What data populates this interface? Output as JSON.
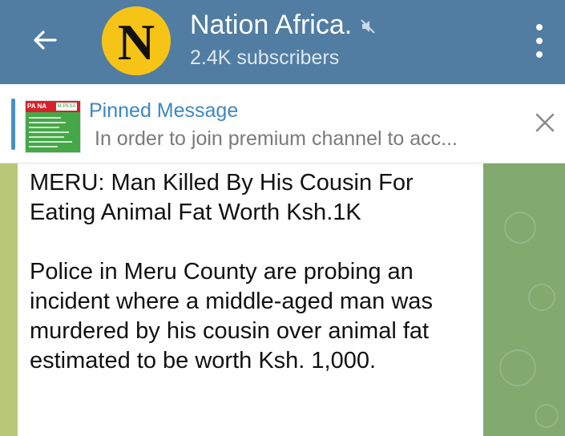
{
  "header": {
    "back_icon": "arrow-left-icon",
    "avatar_letter": "N",
    "avatar_color": "#f6c416",
    "channel_name": "Nation Africa.",
    "mute_icon": "muted-speaker-icon",
    "subscribers": "2.4K subscribers",
    "menu_icon": "more-vertical-icon",
    "bg_color": "#517da2"
  },
  "pinned": {
    "thumb_label": "PA NA",
    "thumb_badge": "M-PESA",
    "title": "Pinned Message",
    "text": "In order to  join premium channel to acc...",
    "close_icon": "close-icon",
    "accent_color": "#3b88c3"
  },
  "message": {
    "headline": "MERU: Man Killed By His Cousin For Eating Animal Fat Worth Ksh.1K",
    "body": "Police in Meru County are probing an incident where a middle-aged man was murdered by his cousin over animal fat estimated to be worth Ksh. 1,000."
  }
}
